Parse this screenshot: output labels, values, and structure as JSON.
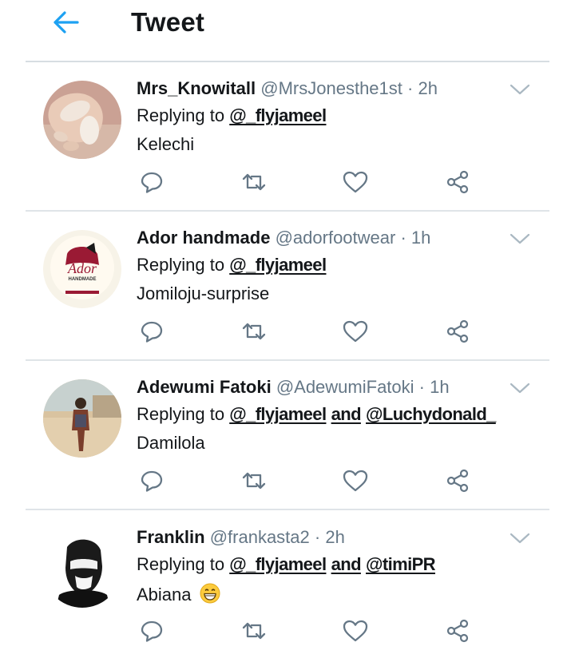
{
  "header": {
    "title": "Tweet",
    "back_icon": "back-arrow-icon",
    "accent": "#1da1f2"
  },
  "replying_label": "Replying to",
  "and_word": "and",
  "tweets": [
    {
      "display_name": "Mrs_Knowitall",
      "handle": "@MrsJonesthe1st",
      "separator": "·",
      "time": "2h",
      "mentions": [
        "@_flyjameel"
      ],
      "text": "Kelechi",
      "avatar": "nails-photo"
    },
    {
      "display_name": "Ador handmade",
      "handle": "@adorfootwear",
      "separator": "·",
      "time": "1h",
      "mentions": [
        "@_flyjameel"
      ],
      "text": "Jomiloju-surprise",
      "avatar": "ador-logo",
      "avatar_text": {
        "brand": "Ador",
        "line2": "HANDMADE"
      }
    },
    {
      "display_name": "Adewumi Fatoki",
      "handle": "@AdewumiFatoki",
      "separator": "·",
      "time": "1h",
      "mentions": [
        "@_flyjameel",
        "@Luchydonald_"
      ],
      "text": "Damilola",
      "avatar": "person-standing-photo"
    },
    {
      "display_name": "Franklin",
      "handle": "@frankasta2",
      "separator": "·",
      "time": "2h",
      "mentions": [
        "@_flyjameel",
        "@timiPR"
      ],
      "text": "Abiana",
      "emoji": "grinning-face-icon",
      "avatar": "bw-portrait"
    }
  ],
  "colors": {
    "text": "#14171a",
    "secondary": "#657786",
    "divider": "#dfe4e8",
    "icon": "#657786"
  }
}
